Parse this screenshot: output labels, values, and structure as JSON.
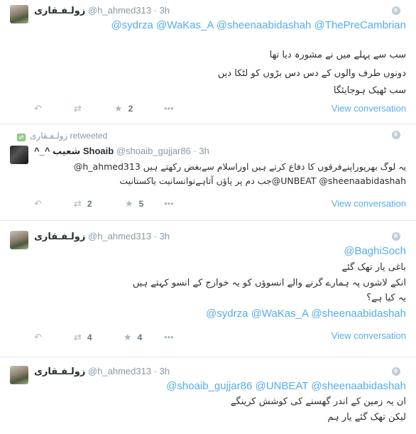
{
  "icons": {
    "reply": "reply-icon",
    "retweet": "retweet-icon",
    "favorite": "star-icon",
    "more": "more-icon",
    "globe": "globe-icon"
  },
  "colors": {
    "link": "#55acee",
    "muted": "#8899a6",
    "text": "#292f33",
    "action": "#aab8c2"
  },
  "tweets": [
    {
      "author_name": "زولـفـقاری",
      "handle": "@h_ahmed313",
      "time": "3h",
      "mentions": "@sydrza @WaKas_A @sheenaabidashah @ThePreCambrian",
      "text_lines": [
        "سب سے پہلے میں نے مشورہ دیا تھا",
        "دونوں طرف والوں کے دس دس بڑوں کو لٹکا دیں",
        "سب ٹھیک ہوجایئگا"
      ],
      "favorites": "2",
      "view_conversation": "View conversation"
    },
    {
      "retweeted_by": "زولـفـقاری",
      "retweeted_label": "retweeted",
      "author_name": "^_^ شعیب Shoaib",
      "handle": "@shoaib_gujjar86",
      "time": "3h",
      "line1": "@h_ahmed313 یہ لوگ بھرپوراپنےفرقوں کا دفاع کرتے ہیں اوراسلام سےبغض رکھتے ہیں",
      "line2": "جب دم پر پاؤں آتاہےتوانسانیت یاکستانیت@UNBEAT @sheenaabidashah",
      "retweets": "2",
      "favorites": "5",
      "view_conversation": "View conversation"
    },
    {
      "author_name": "زولـفـقاری",
      "handle": "@h_ahmed313",
      "time": "3h",
      "mention_top": "@BaghiSoch",
      "text_lines": [
        "باغی یار تھک گئے",
        "انکے لاشوں پہ ہمارے گرنے والے انسوؤں کو یہ خوارج کے انسو کہتے ہیں",
        "یہ کیا ہے؟"
      ],
      "mentions_bottom": "@sydrza @WaKas_A @sheenaabidashah",
      "retweets": "4",
      "favorites": "4",
      "view_conversation": "View conversation"
    },
    {
      "author_name": "زولـفـقاری",
      "handle": "@h_ahmed313",
      "time": "3h",
      "mentions": "@shoaib_gujjar86 @UNBEAT @sheenaabidashah",
      "text_lines": [
        "ان یہ زمین کے اندر گھسنے کی کوشش کرینگے",
        "لیکن تھک گئے یار ہم"
      ]
    }
  ]
}
